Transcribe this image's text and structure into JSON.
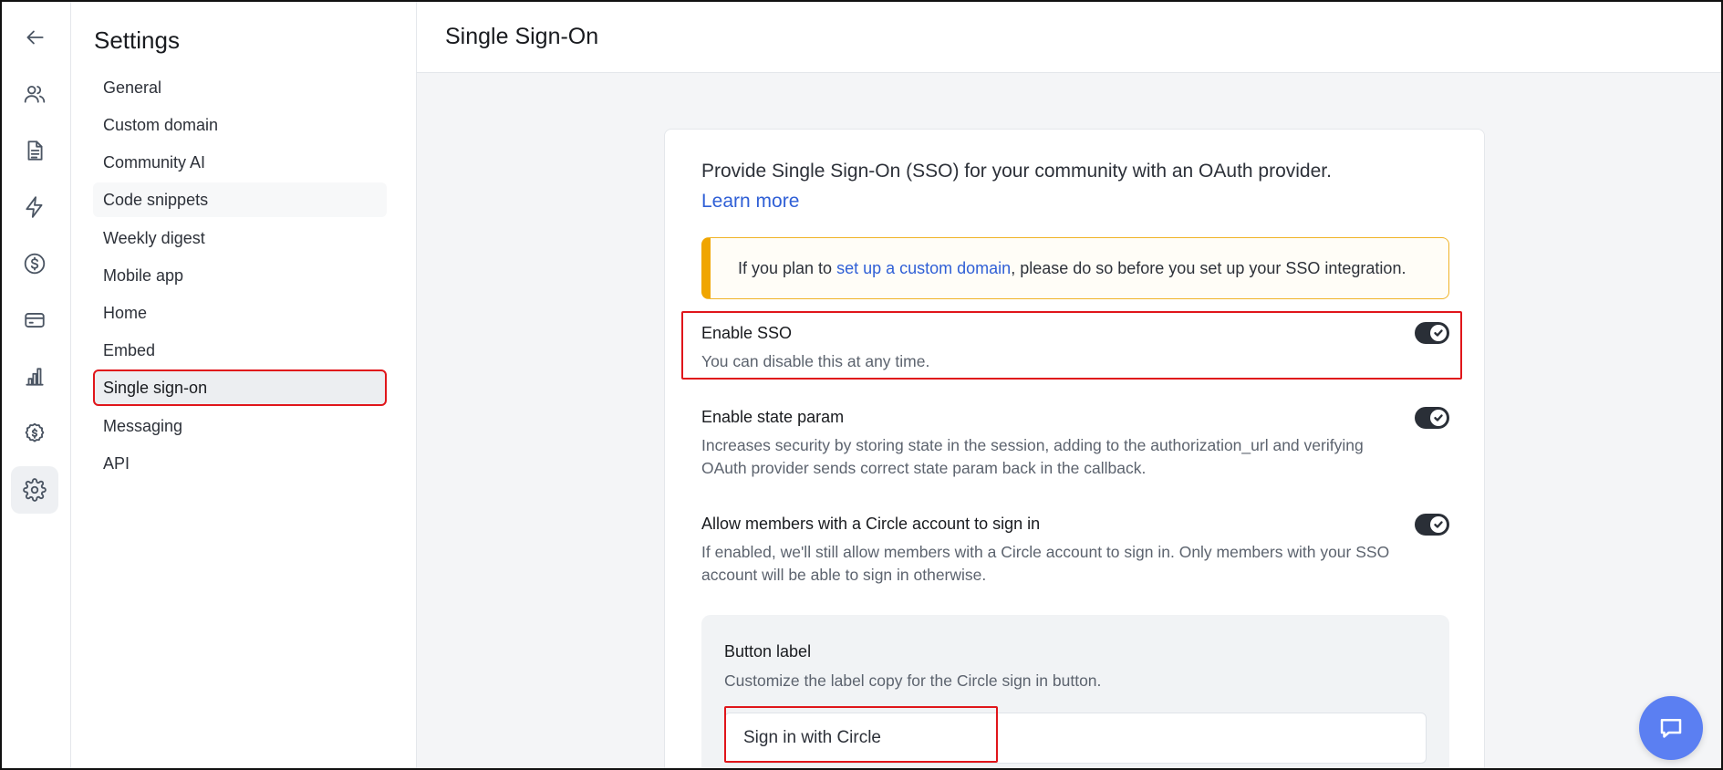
{
  "rail": {
    "items": [
      {
        "icon": "arrow-left-icon",
        "active": false
      },
      {
        "icon": "users-icon",
        "active": false
      },
      {
        "icon": "document-icon",
        "active": false
      },
      {
        "icon": "lightning-icon",
        "active": false
      },
      {
        "icon": "dollar-circle-icon",
        "active": false
      },
      {
        "icon": "credit-card-icon",
        "active": false
      },
      {
        "icon": "bar-chart-icon",
        "active": false
      },
      {
        "icon": "paywall-icon",
        "active": false
      },
      {
        "icon": "gear-icon",
        "active": true
      }
    ]
  },
  "sidebar": {
    "title": "Settings",
    "items": [
      {
        "label": "General"
      },
      {
        "label": "Custom domain"
      },
      {
        "label": "Community AI"
      },
      {
        "label": "Code snippets"
      },
      {
        "label": "Weekly digest"
      },
      {
        "label": "Mobile app"
      },
      {
        "label": "Home"
      },
      {
        "label": "Embed"
      },
      {
        "label": "Single sign-on",
        "selected": true
      },
      {
        "label": "Messaging"
      },
      {
        "label": "API"
      }
    ]
  },
  "header": {
    "title": "Single Sign-On"
  },
  "card": {
    "intro": "Provide Single Sign-On (SSO) for your community with an OAuth provider.",
    "learn_more": "Learn more",
    "alert": {
      "before": "If you plan to ",
      "link": "set up a custom domain",
      "after": ", please do so before you set up your SSO integration."
    },
    "options": [
      {
        "title": "Enable SSO",
        "description": "You can disable this at any time.",
        "enabled": true
      },
      {
        "title": "Enable state param",
        "description": "Increases security by storing state in the session, adding to the authorization_url and verifying OAuth provider sends correct state param back in the callback.",
        "enabled": true
      },
      {
        "title": "Allow members with a Circle account to sign in",
        "description": "If enabled, we'll still allow members with a Circle account to sign in. Only members with your SSO account will be able to sign in otherwise.",
        "enabled": true
      }
    ],
    "button_label": {
      "title": "Button label",
      "description": "Customize the label copy for the Circle sign in button.",
      "value": "Sign in with Circle"
    }
  },
  "chat": {
    "icon": "chat-bubble-icon"
  },
  "colors": {
    "accent": "#5b7ff2",
    "highlight": "#e0161b",
    "warning": "#f0a500",
    "link": "#2f5fd6"
  }
}
